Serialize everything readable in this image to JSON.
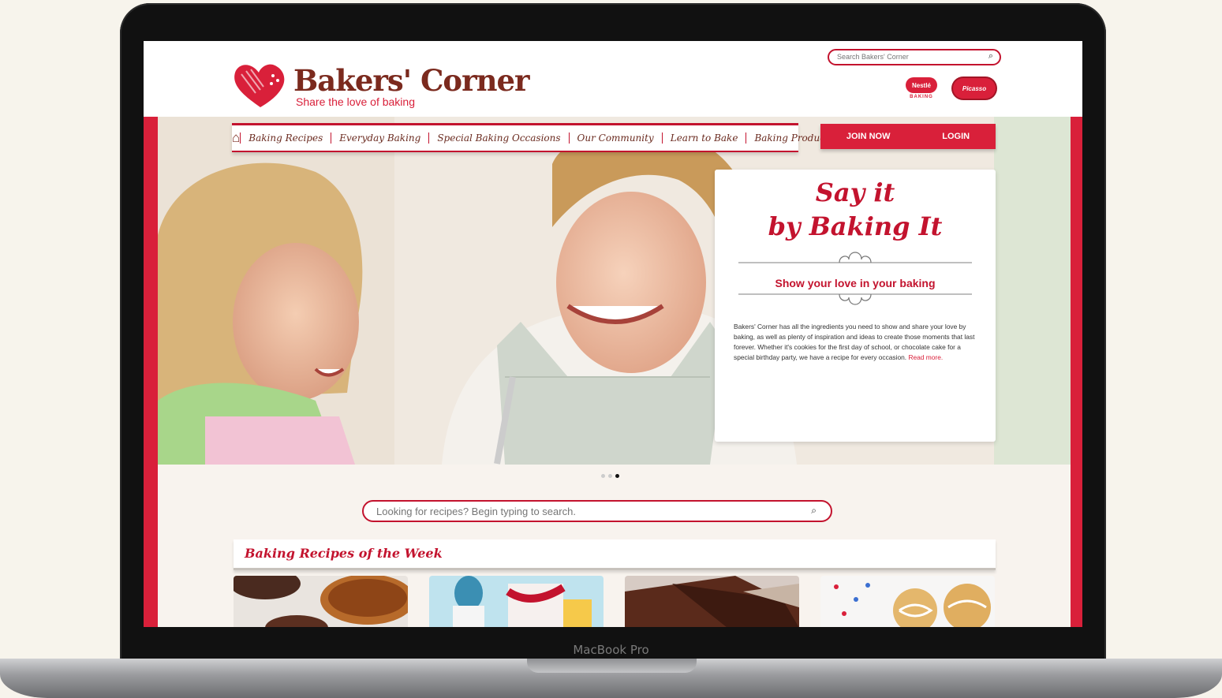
{
  "device": {
    "model_label": "MacBook Pro"
  },
  "brand": {
    "name": "Bakers' Corner",
    "tagline": "Share the love of baking",
    "color_primary": "#d9203a",
    "color_brown": "#7b2a1e"
  },
  "top_search": {
    "placeholder": "Search Bakers' Corner",
    "icon": "search-icon"
  },
  "partner_logos": {
    "nestle_name": "Nestlé",
    "nestle_sub": "BAKING",
    "second_name": "Picasso"
  },
  "nav": {
    "home_icon": "home-icon",
    "items": [
      "Baking Recipes",
      "Everyday Baking",
      "Special Baking Occasions",
      "Our Community",
      "Learn to Bake",
      "Baking Products"
    ],
    "join_label": "JOIN NOW",
    "login_label": "LOGIN"
  },
  "promo": {
    "title_line1": "Say it",
    "title_line2": "by Baking It",
    "subtitle": "Show your love in your baking",
    "body": "Bakers' Corner has all the ingredients you need to show and share your love by baking, as well as plenty of inspiration and ideas to create those moments that last forever. Whether it's cookies for the first day of school, or chocolate cake for a special birthday party, we have a recipe for every occasion.",
    "read_more": "Read more."
  },
  "carousel": {
    "dots": 3,
    "active_index": 2
  },
  "recipe_search": {
    "placeholder": "Looking for recipes? Begin typing to search.",
    "icon": "search-icon"
  },
  "recipes_of_week": {
    "title": "Baking Recipes of the Week"
  }
}
